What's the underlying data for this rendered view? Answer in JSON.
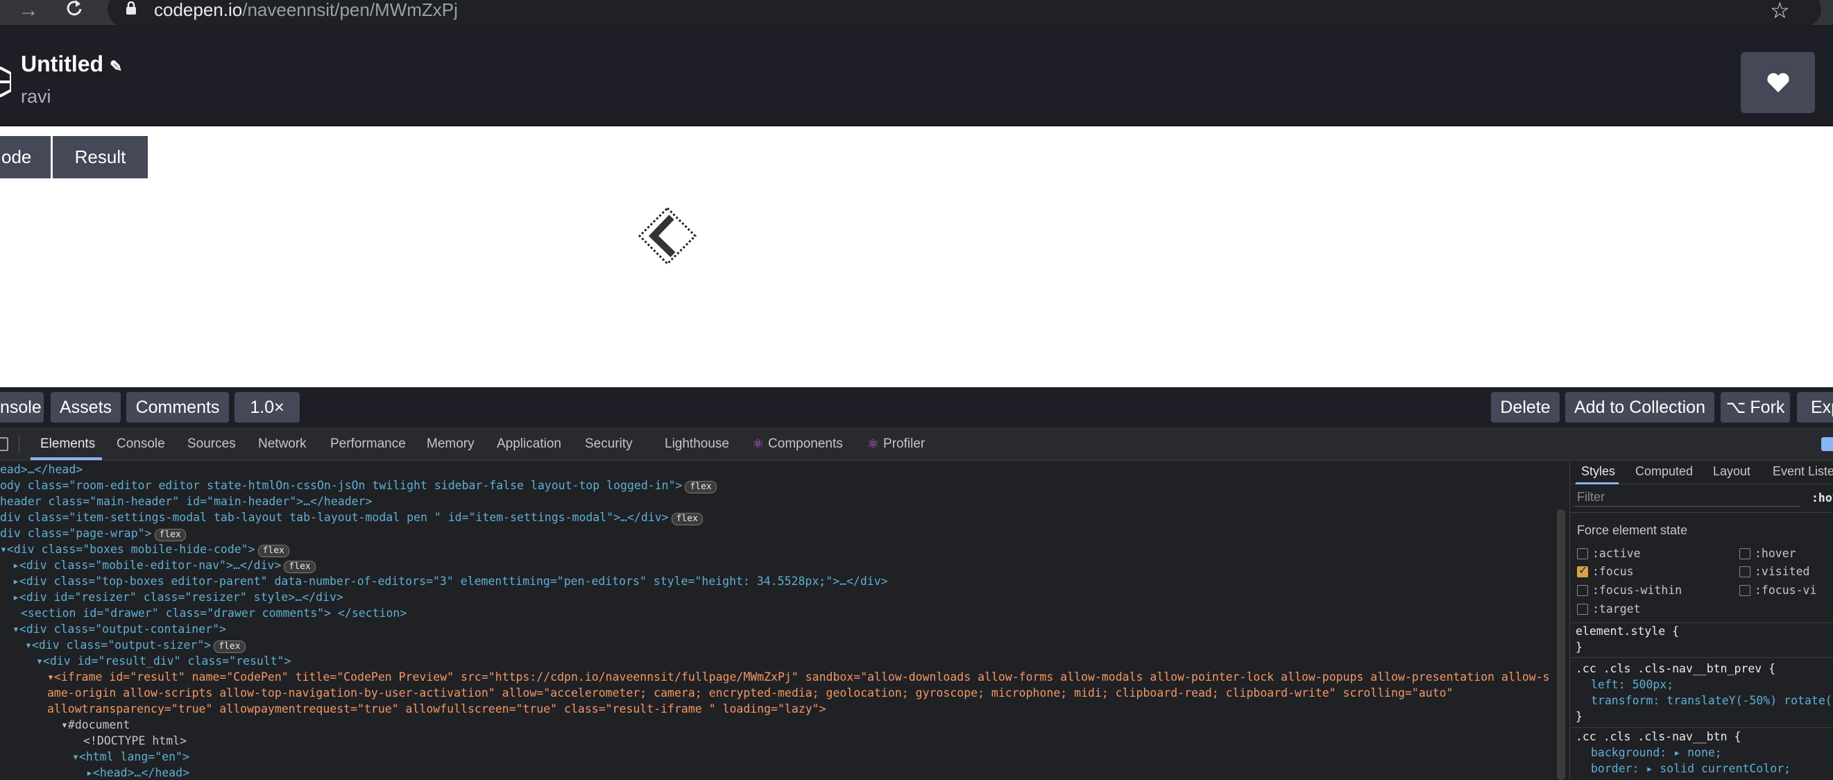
{
  "browser": {
    "url_host": "codepen.io",
    "url_path": "/naveennsit/pen/MWmZxPj"
  },
  "header": {
    "title": "Untitled",
    "owner": "ravi"
  },
  "view_tabs": [
    "ode",
    "Result"
  ],
  "footer": {
    "left_buttons": [
      "nsole",
      "Assets",
      "Comments",
      "1.0×"
    ],
    "right_buttons": [
      "Delete",
      "Add to Collection",
      "Fork",
      "Exp"
    ]
  },
  "devtools": {
    "tabs": [
      "Elements",
      "Console",
      "Sources",
      "Network",
      "Performance",
      "Memory",
      "Application",
      "Security",
      "Lighthouse",
      "Components",
      "Profiler"
    ],
    "selected_tab": "Elements",
    "sidebar_tabs": [
      "Styles",
      "Computed",
      "Layout",
      "Event Liste"
    ],
    "filter_placeholder": "Filter",
    "filter_hov": ":hov",
    "force_state_title": "Force element state",
    "states_left": [
      ":active",
      ":focus",
      ":focus-within",
      ":target"
    ],
    "states_right": [
      ":hover",
      ":visited",
      ":focus-vi"
    ],
    "checked_state": ":focus",
    "styles": [
      "element.style {",
      "}",
      ".cc .cls .cls-nav__btn_prev {",
      "left: 500px;",
      "transform: translateY(-50%) rotate(",
      "}",
      ".cc .cls .cls-nav__btn {",
      "background: ▸ none;",
      "border: ▸ solid currentColor;"
    ],
    "dom_lines": [
      "ead>…</head>",
      "ody class=\"room-editor editor state-htmlOn-cssOn-jsOn twilight sidebar-false   layout-top  logged-in\">",
      "header class=\"main-header\" id=\"main-header\">…</header>",
      "div class=\"item-settings-modal tab-layout tab-layout-modal pen \" id=\"item-settings-modal\">…</div>",
      "div class=\"page-wrap\">",
      "▾<div class=\"boxes mobile-hide-code\">",
      "▸<div class=\"mobile-editor-nav\">…</div>",
      "▸<div class=\"top-boxes editor-parent\" data-number-of-editors=\"3\" elementtiming=\"pen-editors\" style=\"height: 34.5528px;\">…</div>",
      "▸<div id=\"resizer\" class=\"resizer\" style>…</div>",
      "<section id=\"drawer\" class=\"drawer comments\"> </section>",
      "▾<div class=\"output-container\">",
      "▾<div class=\"output-sizer\">",
      "▾<div id=\"result_div\" class=\"result\">",
      "▾<iframe id=\"result\" name=\"CodePen\" title=\"CodePen Preview\" src=\"https://cdpn.io/naveennsit/fullpage/MWmZxPj\" sandbox=\"allow-downloads allow-forms allow-modals allow-pointer-lock allow-popups allow-presentation allow-s",
      "ame-origin allow-scripts allow-top-navigation-by-user-activation\" allow=\"accelerometer; camera; encrypted-media; geolocation; gyroscope; microphone; midi; clipboard-read; clipboard-write\" scrolling=\"auto\"",
      "allowtransparency=\"true\" allowpaymentrequest=\"true\" allowfullscreen=\"true\" class=\"result-iframe \" loading=\"lazy\">",
      "▾#document",
      "<!DOCTYPE html>",
      "▾<html lang=\"en\">",
      "▸<head>…</head>"
    ],
    "badge": "flex"
  }
}
